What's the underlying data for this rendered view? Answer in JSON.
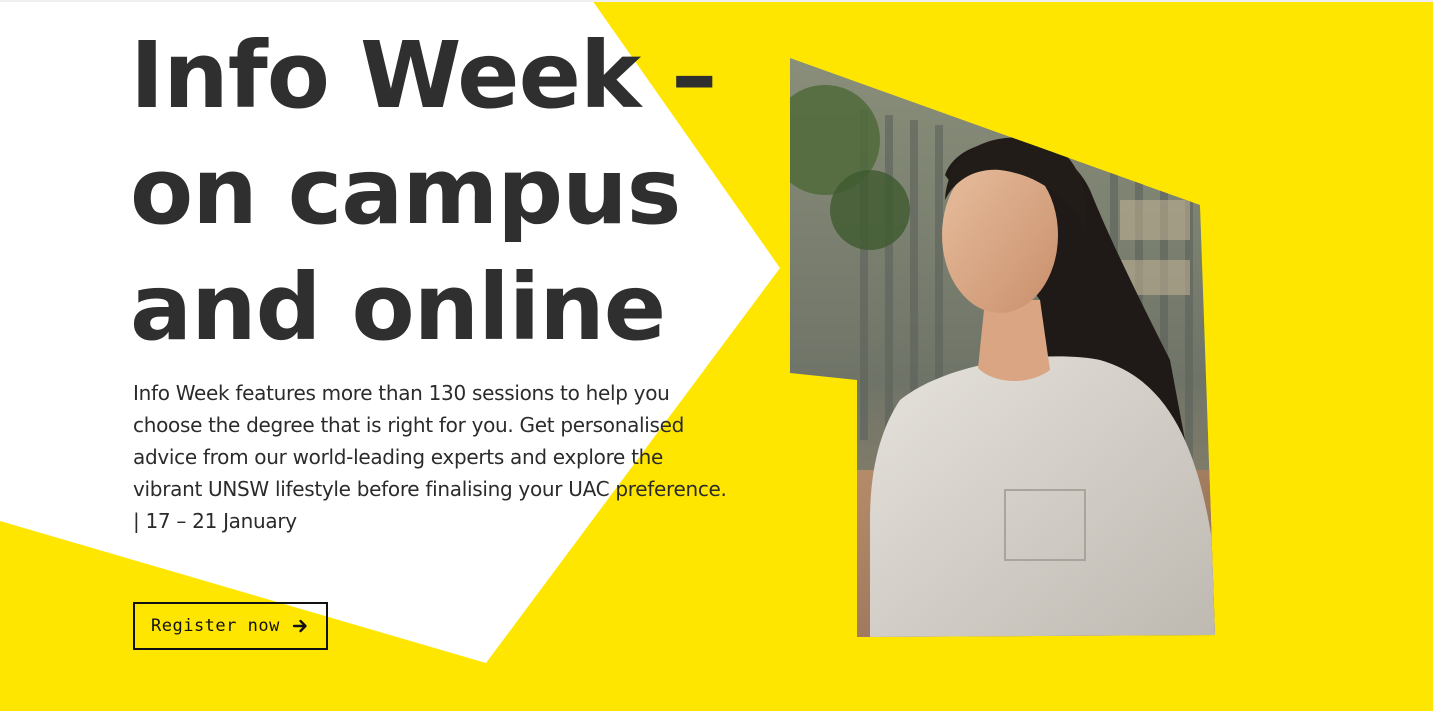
{
  "colors": {
    "accent": "#ffe600",
    "panel": "#ffffff",
    "text": "#2f2f2f"
  },
  "hero": {
    "title_lines": [
      "Info Week –",
      "on campus",
      "and online"
    ],
    "description": "Info Week features more than 130 sessions to help you choose the degree that is right for you. Get personalised advice from our world-leading experts and explore the vibrant UNSW lifestyle before finalising your UAC preference. | 17 – 21 January",
    "cta": {
      "label": "Register now",
      "icon": "arrow-right-icon"
    },
    "image": {
      "icon": "student-photo"
    }
  }
}
